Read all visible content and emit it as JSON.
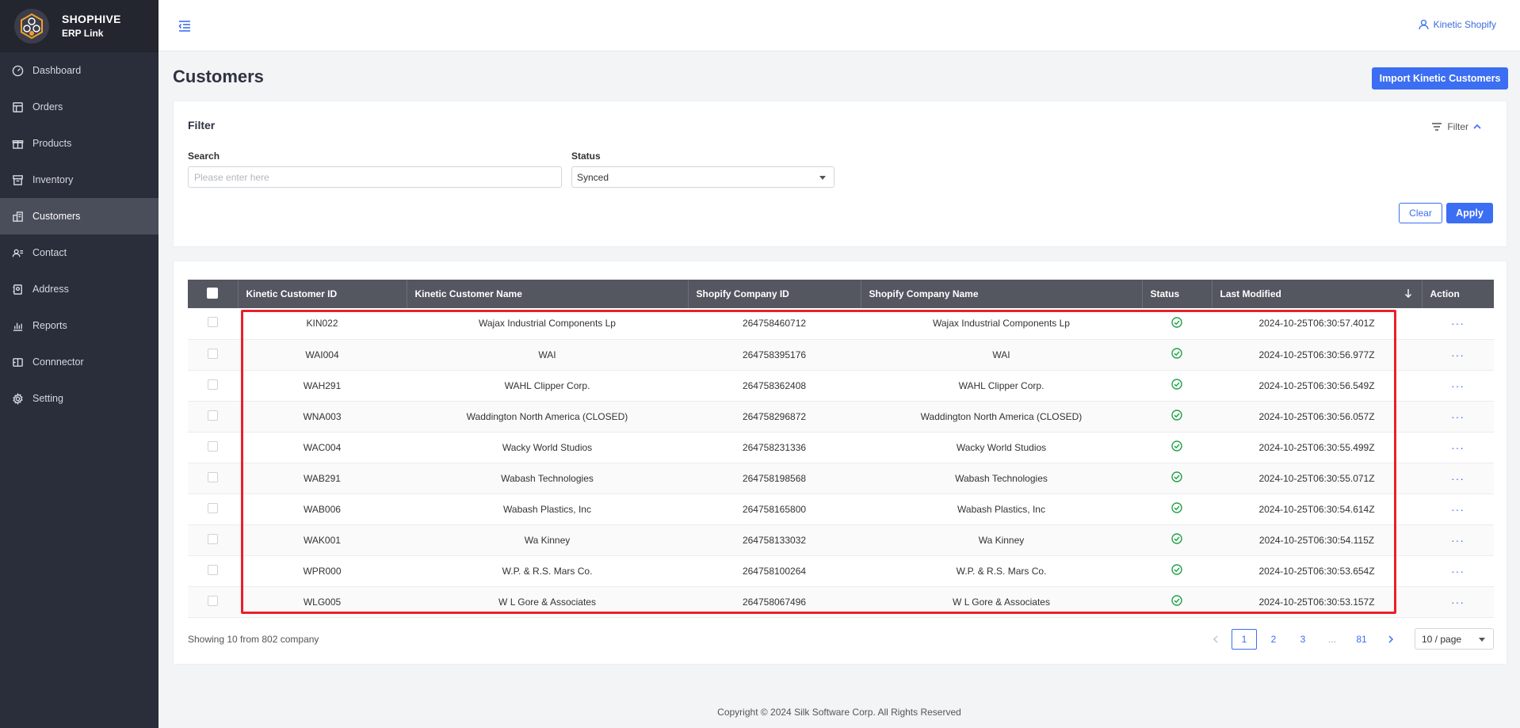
{
  "brand": {
    "title": "SHOPHIVE",
    "subtitle": "ERP Link"
  },
  "sidebar": {
    "items": [
      {
        "label": "Dashboard",
        "icon": "gauge-icon"
      },
      {
        "label": "Orders",
        "icon": "orders-icon"
      },
      {
        "label": "Products",
        "icon": "gift-icon"
      },
      {
        "label": "Inventory",
        "icon": "archive-icon"
      },
      {
        "label": "Customers",
        "icon": "building-icon",
        "active": true
      },
      {
        "label": "Contact",
        "icon": "contact-icon"
      },
      {
        "label": "Address",
        "icon": "address-icon"
      },
      {
        "label": "Reports",
        "icon": "bar-chart-icon"
      },
      {
        "label": "Connnector",
        "icon": "connector-icon"
      },
      {
        "label": "Setting",
        "icon": "gear-icon"
      }
    ]
  },
  "header": {
    "user": "Kinetic Shopify"
  },
  "page": {
    "title": "Customers",
    "import_button": "Import Kinetic Customers"
  },
  "filter": {
    "title": "Filter",
    "toggle_label": "Filter",
    "search_label": "Search",
    "search_placeholder": "Please enter here",
    "status_label": "Status",
    "status_value": "Synced",
    "clear_label": "Clear",
    "apply_label": "Apply"
  },
  "table": {
    "columns": [
      "Kinetic Customer ID",
      "Kinetic Customer Name",
      "Shopify Company ID",
      "Shopify Company Name",
      "Status",
      "Last Modified",
      "Action"
    ],
    "rows": [
      {
        "kid": "KIN022",
        "kname": "Wajax Industrial Components Lp",
        "sid": "264758460712",
        "sname": "Wajax Industrial Components Lp",
        "modified": "2024-10-25T06:30:57.401Z"
      },
      {
        "kid": "WAI004",
        "kname": "WAI",
        "sid": "264758395176",
        "sname": "WAI",
        "modified": "2024-10-25T06:30:56.977Z"
      },
      {
        "kid": "WAH291",
        "kname": "WAHL Clipper Corp.",
        "sid": "264758362408",
        "sname": "WAHL Clipper Corp.",
        "modified": "2024-10-25T06:30:56.549Z"
      },
      {
        "kid": "WNA003",
        "kname": "Waddington North America (CLOSED)",
        "sid": "264758296872",
        "sname": "Waddington North America (CLOSED)",
        "modified": "2024-10-25T06:30:56.057Z"
      },
      {
        "kid": "WAC004",
        "kname": "Wacky World Studios",
        "sid": "264758231336",
        "sname": "Wacky World Studios",
        "modified": "2024-10-25T06:30:55.499Z"
      },
      {
        "kid": "WAB291",
        "kname": "Wabash Technologies",
        "sid": "264758198568",
        "sname": "Wabash Technologies",
        "modified": "2024-10-25T06:30:55.071Z"
      },
      {
        "kid": "WAB006",
        "kname": "Wabash Plastics, Inc",
        "sid": "264758165800",
        "sname": "Wabash Plastics, Inc",
        "modified": "2024-10-25T06:30:54.614Z"
      },
      {
        "kid": "WAK001",
        "kname": "Wa Kinney",
        "sid": "264758133032",
        "sname": "Wa Kinney",
        "modified": "2024-10-25T06:30:54.115Z"
      },
      {
        "kid": "WPR000",
        "kname": "W.P. & R.S. Mars Co.",
        "sid": "264758100264",
        "sname": "W.P. & R.S. Mars Co.",
        "modified": "2024-10-25T06:30:53.654Z"
      },
      {
        "kid": "WLG005",
        "kname": "W L Gore & Associates",
        "sid": "264758067496",
        "sname": "W L Gore & Associates",
        "modified": "2024-10-25T06:30:53.157Z"
      }
    ],
    "status_icon": "check-circle-icon",
    "action_text": "···"
  },
  "pagination": {
    "summary": "Showing 10 from 802 company",
    "pages": [
      "1",
      "2",
      "3",
      "...",
      "81"
    ],
    "current": "1",
    "page_size": "10 / page"
  },
  "footer": {
    "copyright": "Copyright © 2024 Silk Software Corp. All Rights Reserved"
  },
  "colors": {
    "accent": "#3b6ef2",
    "sidebar": "#2a2d3a",
    "status_ok": "#22a34a",
    "highlight": "#e8202a"
  }
}
